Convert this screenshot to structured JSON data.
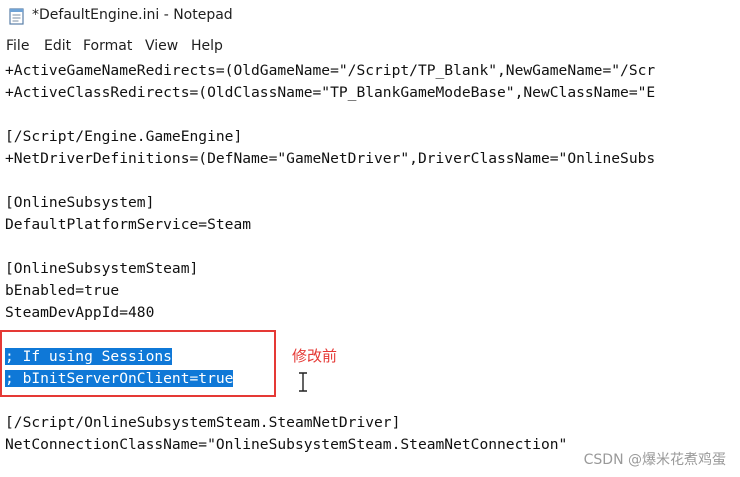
{
  "window": {
    "title": "*DefaultEngine.ini - Notepad"
  },
  "menu": [
    "File",
    "Edit",
    "Format",
    "View",
    "Help"
  ],
  "editor": {
    "lines": [
      "+ActiveGameNameRedirects=(OldGameName=\"/Script/TP_Blank\",NewGameName=\"/Scr",
      "+ActiveClassRedirects=(OldClassName=\"TP_BlankGameModeBase\",NewClassName=\"E",
      "",
      "[/Script/Engine.GameEngine]",
      "+NetDriverDefinitions=(DefName=\"GameNetDriver\",DriverClassName=\"OnlineSubs",
      "",
      "[OnlineSubsystem]",
      "DefaultPlatformService=Steam",
      "",
      "[OnlineSubsystemSteam]",
      "bEnabled=true",
      "SteamDevAppId=480",
      "",
      "; If using Sessions",
      "; bInitServerOnClient=true",
      "",
      "[/Script/OnlineSubsystemSteam.SteamNetDriver]",
      "NetConnectionClassName=\"OnlineSubsystemSteam.SteamNetConnection\""
    ]
  },
  "annotation": {
    "label": "修改前",
    "color": "#e53935"
  },
  "selection_color": "#0f78d7",
  "watermark": "CSDN @爆米花煮鸡蛋"
}
